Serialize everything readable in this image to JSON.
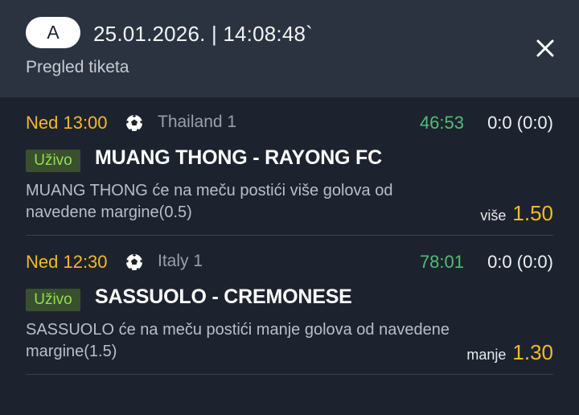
{
  "header": {
    "badge": "A",
    "datetime": "25.01.2026. | 14:08:48`",
    "subtitle": "Pregled tiketa",
    "close_icon": "close-icon"
  },
  "matches": [
    {
      "time": "Ned 13:00",
      "sport_icon": "soccer-ball-icon",
      "league": "Thailand 1",
      "clock": "46:53",
      "score": "0:0 (0:0)",
      "live_label": "Uživo",
      "teams": "MUANG THONG - RAYONG FC",
      "description": "MUANG THONG će na meču postići više golova od navedene margine(0.5)",
      "pick_label": "više",
      "odd": "1.50"
    },
    {
      "time": "Ned 12:30",
      "sport_icon": "soccer-ball-icon",
      "league": "Italy 1",
      "clock": "78:01",
      "score": "0:0 (0:0)",
      "live_label": "Uživo",
      "teams": "SASSUOLO - CREMONESE",
      "description": "SASSUOLO će na meču postići manje golova od navedene margine(1.5)",
      "pick_label": "manje",
      "odd": "1.30"
    }
  ],
  "colors": {
    "background": "#1d232e",
    "header": "#2c3340",
    "accent": "#f5b829",
    "clock": "#4fbf72",
    "live": "#8fdf4f"
  }
}
